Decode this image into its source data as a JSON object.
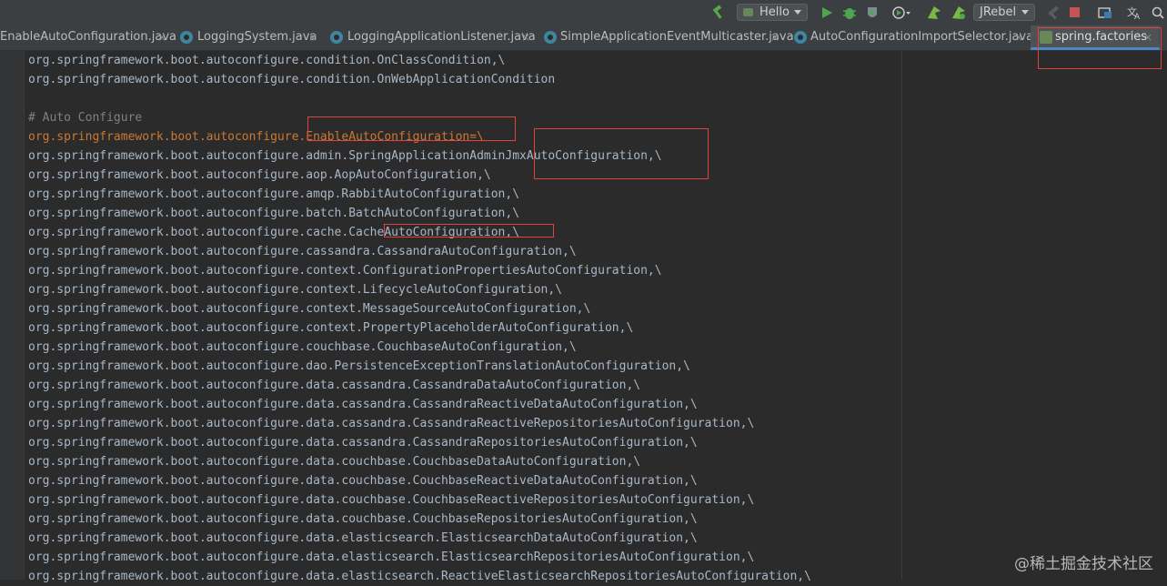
{
  "toolbar": {
    "run_config": "Hello",
    "jrebel_label": "JRebel",
    "icons": [
      "hammer-icon",
      "play-icon",
      "debug-icon",
      "coverage-icon",
      "profile-icon",
      "jrebel-run-icon",
      "jrebel-debug-icon",
      "tools-icon",
      "stop-icon",
      "structure-icon",
      "translate-icon",
      "search-icon"
    ],
    "colors": {
      "build": "#5aa84a",
      "run": "#4fa651",
      "stop": "#c75450"
    }
  },
  "tabs": [
    {
      "label": "EnableAutoConfiguration.java",
      "close": "×"
    },
    {
      "label": "LoggingSystem.java",
      "close": "×"
    },
    {
      "label": "LoggingApplicationListener.java",
      "close": "×"
    },
    {
      "label": "SimpleApplicationEventMulticaster.java",
      "close": "×"
    },
    {
      "label": "AutoConfigurationImportSelector.java",
      "close": "×"
    },
    {
      "label": "spring.factories",
      "close": "×",
      "active": true
    }
  ],
  "code_lines": [
    "org.springframework.boot.autoconfigure.condition.OnClassCondition,\\",
    "org.springframework.boot.autoconfigure.condition.OnWebApplicationCondition",
    "",
    "# Auto Configure",
    "org.springframework.boot.autoconfigure.EnableAutoConfiguration=\\",
    "org.springframework.boot.autoconfigure.admin.SpringApplicationAdminJmxAutoConfiguration,\\",
    "org.springframework.boot.autoconfigure.aop.AopAutoConfiguration,\\",
    "org.springframework.boot.autoconfigure.amqp.RabbitAutoConfiguration,\\",
    "org.springframework.boot.autoconfigure.batch.BatchAutoConfiguration,\\",
    "org.springframework.boot.autoconfigure.cache.CacheAutoConfiguration,\\",
    "org.springframework.boot.autoconfigure.cassandra.CassandraAutoConfiguration,\\",
    "org.springframework.boot.autoconfigure.context.ConfigurationPropertiesAutoConfiguration,\\",
    "org.springframework.boot.autoconfigure.context.LifecycleAutoConfiguration,\\",
    "org.springframework.boot.autoconfigure.context.MessageSourceAutoConfiguration,\\",
    "org.springframework.boot.autoconfigure.context.PropertyPlaceholderAutoConfiguration,\\",
    "org.springframework.boot.autoconfigure.couchbase.CouchbaseAutoConfiguration,\\",
    "org.springframework.boot.autoconfigure.dao.PersistenceExceptionTranslationAutoConfiguration,\\",
    "org.springframework.boot.autoconfigure.data.cassandra.CassandraDataAutoConfiguration,\\",
    "org.springframework.boot.autoconfigure.data.cassandra.CassandraReactiveDataAutoConfiguration,\\",
    "org.springframework.boot.autoconfigure.data.cassandra.CassandraReactiveRepositoriesAutoConfiguration,\\",
    "org.springframework.boot.autoconfigure.data.cassandra.CassandraRepositoriesAutoConfiguration,\\",
    "org.springframework.boot.autoconfigure.data.couchbase.CouchbaseDataAutoConfiguration,\\",
    "org.springframework.boot.autoconfigure.data.couchbase.CouchbaseReactiveDataAutoConfiguration,\\",
    "org.springframework.boot.autoconfigure.data.couchbase.CouchbaseReactiveRepositoriesAutoConfiguration,\\",
    "org.springframework.boot.autoconfigure.data.couchbase.CouchbaseRepositoriesAutoConfiguration,\\",
    "org.springframework.boot.autoconfigure.data.elasticsearch.ElasticsearchDataAutoConfiguration,\\",
    "org.springframework.boot.autoconfigure.data.elasticsearch.ElasticsearchRepositoriesAutoConfiguration,\\",
    "org.springframework.boot.autoconfigure.data.elasticsearch.ReactiveElasticsearchRepositoriesAutoConfiguration,\\"
  ],
  "editor_colors": {
    "text": "#a9b7c6",
    "comment": "#808080",
    "key": "#cc7832",
    "highlight_box": "#e0443e"
  },
  "watermark": "@稀土掘金技术社区"
}
